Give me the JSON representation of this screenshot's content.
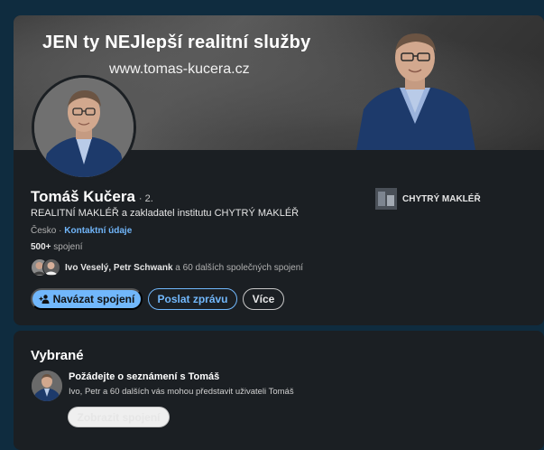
{
  "banner": {
    "title": "JEN ty NEJlepší realitní služby",
    "url": "www.tomas-kucera.cz"
  },
  "profile": {
    "name": "Tomáš Kučera",
    "degree": "· 2.",
    "headline": "REALITNÍ MAKLÉŘ a zakladatel institutu CHYTRÝ MAKLÉŘ",
    "location": "Česko",
    "location_separator": " · ",
    "contact_link": "Kontaktní údaje",
    "connections_count": "500+",
    "connections_label": " spojení",
    "mutual_names": "Ivo Veselý, Petr Schwank",
    "mutual_rest": " a 60 dalších společných spojení",
    "company": "CHYTRÝ MAKLÉŘ"
  },
  "actions": {
    "connect_label": "Navázat spojení",
    "message_label": "Poslat zprávu",
    "more_label": "Více"
  },
  "featured": {
    "title": "Vybrané",
    "headline": "Požádejte o seznámení s Tomáš",
    "subtext": "Ivo, Petr a 60 dalších vás mohou představit uživateli Tomáš",
    "button_label": "Zobrazit spojení"
  },
  "colors": {
    "accent": "#71b7fb",
    "card_bg": "#1b1f23",
    "page_bg": "#0f2c3f"
  }
}
